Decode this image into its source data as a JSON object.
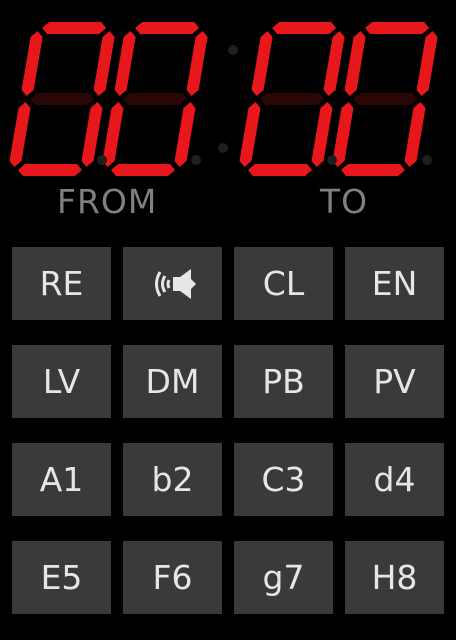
{
  "display": {
    "from_digits": [
      "0",
      "0"
    ],
    "to_digits": [
      "0",
      "0"
    ],
    "digit_color": "#e8171c",
    "unlit_color": "#2b0606"
  },
  "labels": {
    "from": "FROM",
    "to": "TO"
  },
  "keypad": {
    "rows": [
      [
        {
          "label": "RE"
        },
        {
          "label": "",
          "icon": "speaker-sound-icon"
        },
        {
          "label": "CL"
        },
        {
          "label": "EN"
        }
      ],
      [
        {
          "label": "LV"
        },
        {
          "label": "DM"
        },
        {
          "label": "PB"
        },
        {
          "label": "PV"
        }
      ],
      [
        {
          "label": "A1"
        },
        {
          "label": "b2"
        },
        {
          "label": "C3"
        },
        {
          "label": "d4"
        }
      ],
      [
        {
          "label": "E5"
        },
        {
          "label": "F6"
        },
        {
          "label": "g7"
        },
        {
          "label": "H8"
        }
      ]
    ]
  }
}
